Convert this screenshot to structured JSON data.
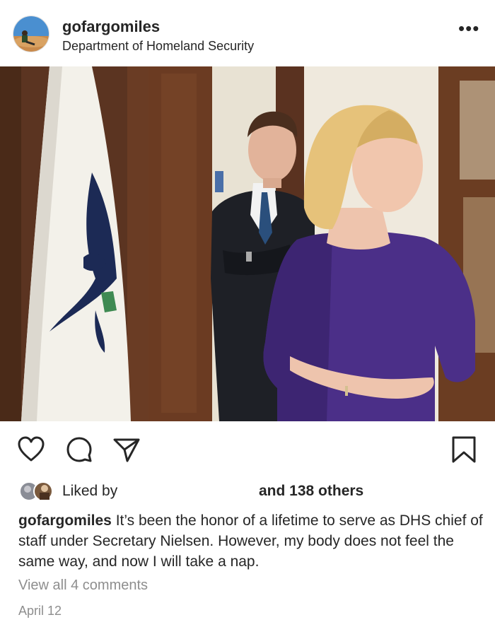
{
  "post": {
    "username": "gofargomiles",
    "location": "Department of Homeland Security",
    "more_label": "•••"
  },
  "likes": {
    "liked_by": "Liked by",
    "others": "and 138 others"
  },
  "caption": {
    "username": "gofargomiles",
    "text": "It’s been the honor of a lifetime to serve as DHS chief of staff under Secretary Nielsen. However, my body does not feel the same way, and now I will take a nap."
  },
  "comments": {
    "view_all": "View all 4 comments"
  },
  "date": "April 12",
  "icons": {
    "like": "heart-icon",
    "comment": "comment-icon",
    "share": "send-icon",
    "save": "bookmark-icon"
  },
  "colors": {
    "text": "#262626",
    "muted": "#8e8e8e",
    "dress": "#4a2f86"
  }
}
